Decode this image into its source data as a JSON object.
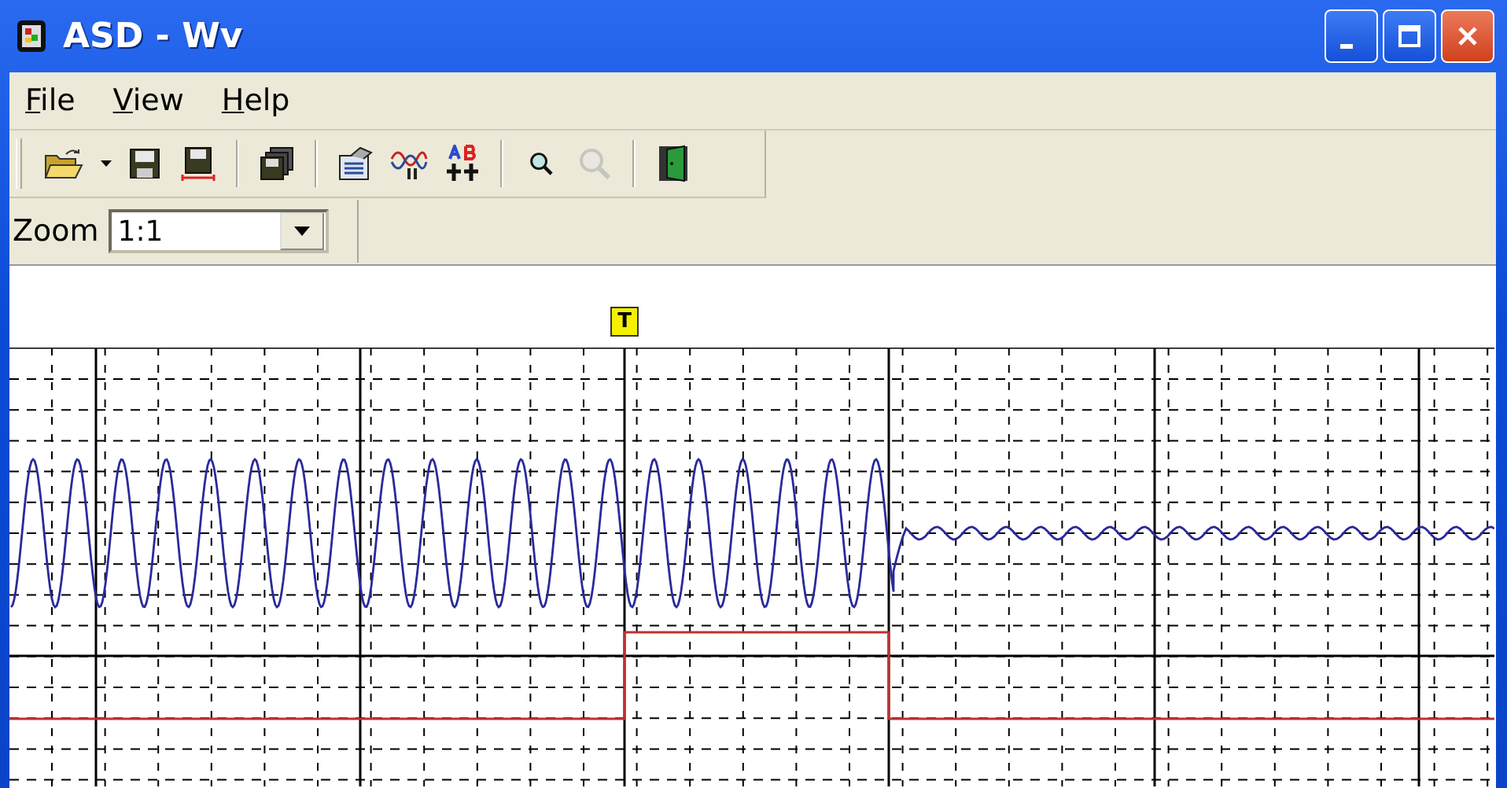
{
  "window": {
    "title": "ASD - Wv"
  },
  "menu": [
    {
      "label": "File"
    },
    {
      "label": "View"
    },
    {
      "label": "Help"
    }
  ],
  "toolbar": [
    [
      {
        "kind": "open",
        "disabled": false
      },
      {
        "kind": "dropdown",
        "disabled": false
      },
      {
        "kind": "save",
        "disabled": false
      },
      {
        "kind": "save-range",
        "disabled": false
      }
    ],
    [
      {
        "kind": "copy",
        "disabled": false
      }
    ],
    [
      {
        "kind": "properties",
        "disabled": false
      },
      {
        "kind": "wave-settings",
        "disabled": false
      },
      {
        "kind": "ab",
        "disabled": false
      }
    ],
    [
      {
        "kind": "zoom-in",
        "disabled": false
      },
      {
        "kind": "zoom-out",
        "disabled": true
      }
    ],
    [
      {
        "kind": "exit",
        "disabled": false
      }
    ]
  ],
  "zoom": {
    "label": "Zoom",
    "value": "1:1"
  },
  "plot": {
    "trigger_marker": "T"
  }
}
